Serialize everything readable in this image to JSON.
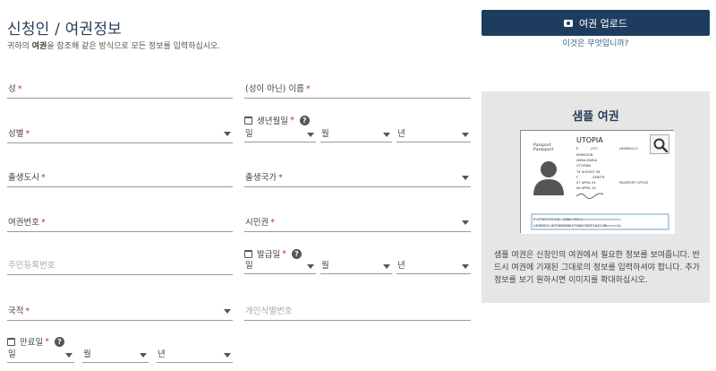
{
  "page": {
    "title": "신청인 / 여권정보",
    "instruction_pre": "귀하의 ",
    "instruction_bold": "여권",
    "instruction_post": "을 참조해 같은 방식으로 모든 정보를 입력하십시오."
  },
  "fields": {
    "surname": "성",
    "given_name": "(성이 아닌) 이름",
    "gender": "성별",
    "birth_city": "출생도시",
    "birth_country": "출생국가",
    "passport_number": "여권번호",
    "citizenship": "시민권",
    "national_id_placeholder": "주민등록번호",
    "nationality": "국적",
    "personal_id_placeholder": "개인식별번호",
    "required_mark": "*"
  },
  "dates": {
    "birth": {
      "label": "생년월일",
      "day": "일",
      "month": "월",
      "year": "년"
    },
    "issue": {
      "label": "발급일",
      "day": "일",
      "month": "월",
      "year": "년"
    },
    "expiry": {
      "label": "만료일",
      "day": "일",
      "month": "월",
      "year": "년"
    },
    "help_glyph": "?"
  },
  "upload": {
    "button_label": "여권 업로드",
    "what_link": "이것은 무엇입니까?"
  },
  "sample": {
    "title": "샘플 여권",
    "description": "샘플 여권은 신청인의 여권에서 필요한 정보를 보여줍니다. 반드시 여권에 기재된 그대로의 정보를 입력하셔야 합니다. 추가 정보를 보기 원하시면 이미지를 확대하십시오.",
    "passport": {
      "country": "UTOPIA",
      "label_en": "Passport",
      "label_alt": "Passeport",
      "type": "P",
      "code": "UTO",
      "number": "L898902C3",
      "surname": "ERIKSSON",
      "given_names": "ANNA MARIA",
      "nationality": "UTOPIAN",
      "birth_date": "74 AUGUST 06",
      "sex": "F",
      "birth_place": "ZENITH",
      "issue_date": "07 APRIL 04",
      "authority": "PASSPORT OFFICE",
      "expiry_date": "06 APRIL 14",
      "mrz_line1": "P<UTOERIKSSON<<ANNA<MARIA<<<<<<<<<<<<<<<<<<<",
      "mrz_line2": "L898902C<3UTO6908061F9406236ZE184226B<<<<<14"
    }
  },
  "colors": {
    "accent": "#1e3d5e",
    "link": "#2f5f8a",
    "required": "#c0392b",
    "panel_bg": "#e6e6e6"
  }
}
